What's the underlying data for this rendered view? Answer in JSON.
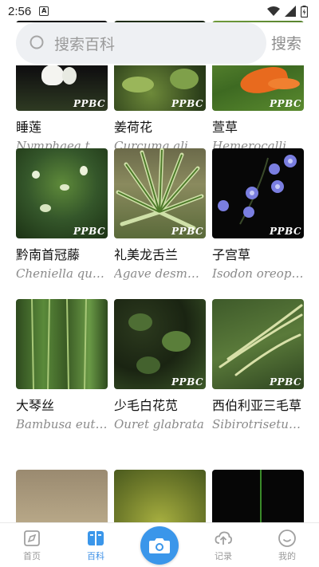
{
  "status": {
    "time": "2:56",
    "notif_icon": "A"
  },
  "search": {
    "placeholder": "搜索百科",
    "button_label": "搜索"
  },
  "watermark": "PPBC",
  "plants": [
    {
      "name": "睡莲",
      "latin": "Nymphaea tetragona"
    },
    {
      "name": "姜荷花",
      "latin": "Curcuma alismatifolia"
    },
    {
      "name": "萱草",
      "latin": "Hemerocallis fulva"
    },
    {
      "name": "黔南首冠藤",
      "latin": "Cheniella quinnanensis"
    },
    {
      "name": "礼美龙舌兰",
      "latin": "Agave desmettiana"
    },
    {
      "name": "子宫草",
      "latin": "Isodon oreophilus"
    },
    {
      "name": "大琴丝",
      "latin": "Bambusa eutuldoides"
    },
    {
      "name": "少毛白花苋",
      "latin": "Ouret glabrata"
    },
    {
      "name": "西伯利亚三毛草",
      "latin": "Sibirotrisetum sibiricum"
    },
    {
      "name": "",
      "latin": ""
    },
    {
      "name": "",
      "latin": ""
    },
    {
      "name": "",
      "latin": ""
    }
  ],
  "nav": [
    {
      "label": "首页",
      "icon": "compass-icon",
      "active": false
    },
    {
      "label": "百科",
      "icon": "book-icon",
      "active": true
    },
    {
      "label": "",
      "icon": "camera-icon",
      "active": false
    },
    {
      "label": "记录",
      "icon": "upload-cloud-icon",
      "active": false
    },
    {
      "label": "我的",
      "icon": "smile-icon",
      "active": false
    }
  ],
  "colors": {
    "accent": "#3a96ea",
    "search_bg": "#eef0f3"
  }
}
